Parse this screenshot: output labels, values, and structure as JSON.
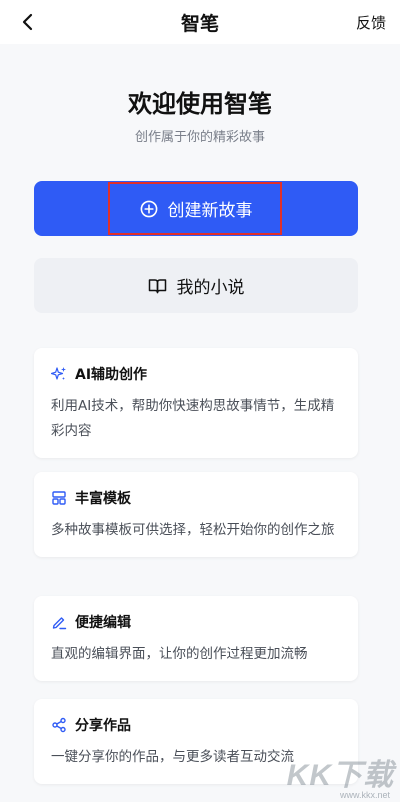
{
  "nav": {
    "back_icon": "chevron-left-icon",
    "title": "智笔",
    "feedback_label": "反馈"
  },
  "hero": {
    "title": "欢迎使用智笔",
    "subtitle": "创作属于你的精彩故事"
  },
  "actions": {
    "create": {
      "icon": "plus-circle-icon",
      "label": "创建新故事"
    },
    "my_novels": {
      "icon": "book-open-icon",
      "label": "我的小说"
    }
  },
  "features": [
    {
      "icon": "sparkles-icon",
      "title": "AI辅助创作",
      "desc": "利用AI技术，帮助你快速构思故事情节，生成精彩内容"
    },
    {
      "icon": "template-icon",
      "title": "丰富模板",
      "desc": "多种故事模板可供选择，轻松开始你的创作之旅"
    },
    {
      "icon": "pencil-icon",
      "title": "便捷编辑",
      "desc": "直观的编辑界面，让你的创作过程更加流畅"
    },
    {
      "icon": "share-icon",
      "title": "分享作品",
      "desc": "一键分享你的作品，与更多读者互动交流"
    }
  ],
  "watermark": {
    "text": "KK下载",
    "url": "www.kkx.net"
  },
  "colors": {
    "primary": "#2f5bf5",
    "secondary_bg": "#eef0f4",
    "page_bg": "#f7f8fa",
    "highlight_border": "#e0302b"
  }
}
